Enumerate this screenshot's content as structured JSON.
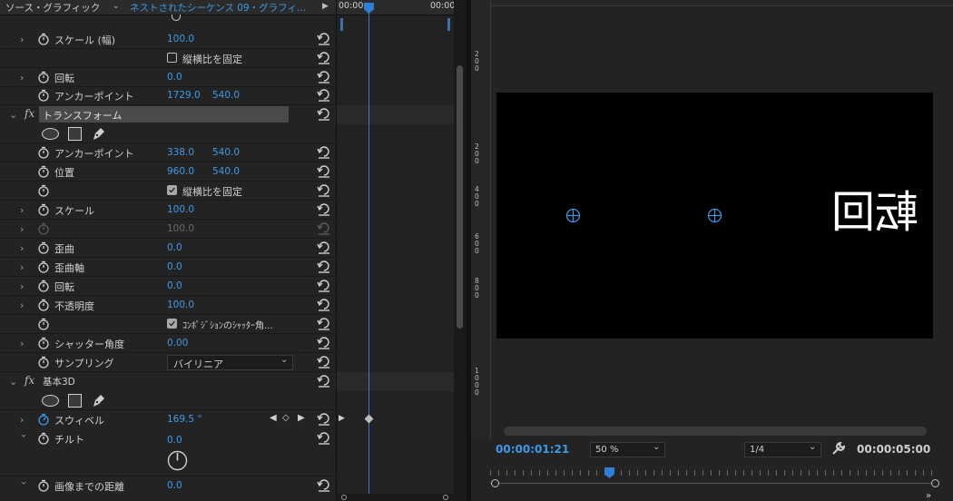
{
  "panel": {
    "tab_source": "ソース・グラフィック",
    "tab_sequence": "ネストされたシーケンス 09・グラフィ...",
    "time_start": "00:00",
    "time_end": "00:00"
  },
  "rows": {
    "scale_width": {
      "label": "スケール (幅)",
      "v1": "100.0"
    },
    "lock_ratio_1": {
      "label": "縦横比を固定"
    },
    "rotation_1": {
      "label": "回転",
      "v1": "0.0"
    },
    "anchor_1": {
      "label": "アンカーポイント",
      "v1": "1729.0",
      "v2": "540.0"
    },
    "transform": {
      "fx": "fx",
      "label": "トランスフォーム"
    },
    "anchor_2": {
      "label": "アンカーポイント",
      "v1": "338.0",
      "v2": "540.0"
    },
    "position": {
      "label": "位置",
      "v1": "960.0",
      "v2": "540.0"
    },
    "lock_ratio_2": {
      "label": "縦横比を固定"
    },
    "scale": {
      "label": "スケール",
      "v1": "100.0"
    },
    "scale_dim": {
      "v1": "100.0"
    },
    "skew": {
      "label": "歪曲",
      "v1": "0.0"
    },
    "skew_axis": {
      "label": "歪曲軸",
      "v1": "0.0"
    },
    "rotation_2": {
      "label": "回転",
      "v1": "0.0"
    },
    "opacity": {
      "label": "不透明度",
      "v1": "100.0"
    },
    "comp_shutter": {
      "label": "ｺﾝﾎﾟｼﾞｼｮﾝのｼｬｯﾀｰ角..."
    },
    "shutter_angle": {
      "label": "シャッター角度",
      "v1": "0.00"
    },
    "sampling": {
      "label": "サンプリング",
      "value": "バイリニア"
    },
    "basic3d": {
      "fx": "fx",
      "label": "基本3D"
    },
    "swivel": {
      "label": "スウィベル",
      "v1": "169.5 °"
    },
    "tilt": {
      "label": "チルト",
      "v1": "0.0"
    },
    "distance": {
      "label": "画像までの距離",
      "v1": "0.0"
    }
  },
  "monitor": {
    "ruler_marks": [
      "2\n0\n0",
      "2\n0\n0",
      "4\n0\n0",
      "6\n0\n0",
      "8\n0\n0",
      "1\n0\n0\n0"
    ],
    "canvas_text": "転回",
    "current_time": "00:00:01:21",
    "zoom": "50 %",
    "resolution": "1/4",
    "duration": "00:00:05:00"
  }
}
